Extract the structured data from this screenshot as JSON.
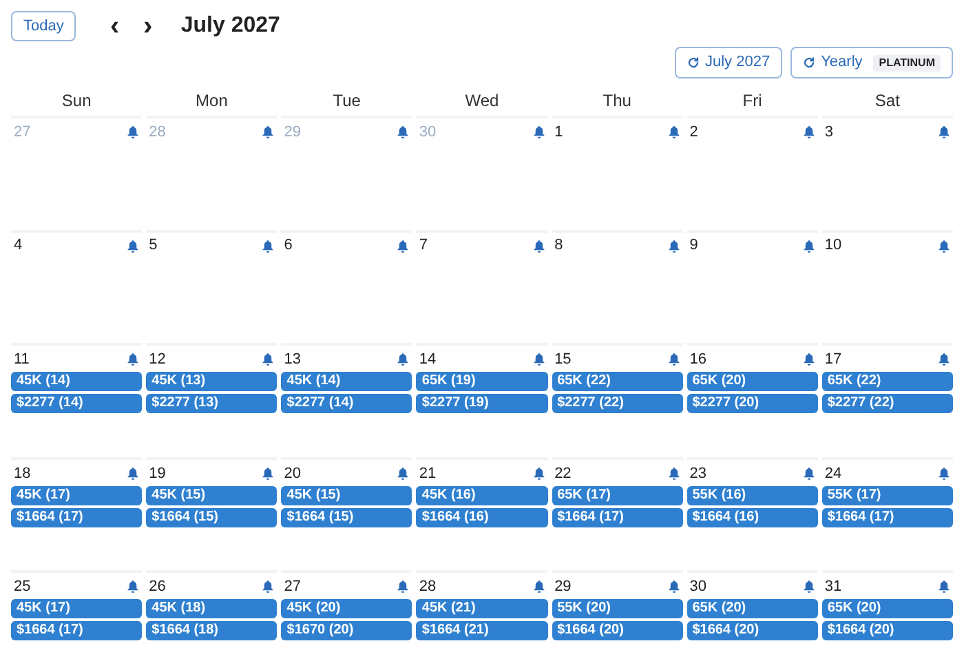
{
  "toolbar": {
    "today_button": "Today",
    "prev_icon": "‹",
    "next_icon": "›",
    "title": "July 2027"
  },
  "actions": [
    {
      "label": "July 2027"
    },
    {
      "label": "Yearly",
      "badge": "PLATINUM"
    }
  ],
  "weekdays": [
    "Sun",
    "Mon",
    "Tue",
    "Wed",
    "Thu",
    "Fri",
    "Sat"
  ],
  "days": [
    {
      "day": "27",
      "outside": true
    },
    {
      "day": "28",
      "outside": true
    },
    {
      "day": "29",
      "outside": true
    },
    {
      "day": "30",
      "outside": true
    },
    {
      "day": "1",
      "outside": false
    },
    {
      "day": "2",
      "outside": false
    },
    {
      "day": "3",
      "outside": false
    },
    {
      "day": "4",
      "outside": false
    },
    {
      "day": "5",
      "outside": false
    },
    {
      "day": "6",
      "outside": false
    },
    {
      "day": "7",
      "outside": false
    },
    {
      "day": "8",
      "outside": false
    },
    {
      "day": "9",
      "outside": false
    },
    {
      "day": "10",
      "outside": false
    },
    {
      "day": "11",
      "outside": false,
      "events": [
        "45K (14)",
        "$2277 (14)"
      ]
    },
    {
      "day": "12",
      "outside": false,
      "events": [
        "45K (13)",
        "$2277 (13)"
      ]
    },
    {
      "day": "13",
      "outside": false,
      "events": [
        "45K (14)",
        "$2277 (14)"
      ]
    },
    {
      "day": "14",
      "outside": false,
      "events": [
        "65K (19)",
        "$2277 (19)"
      ]
    },
    {
      "day": "15",
      "outside": false,
      "events": [
        "65K (22)",
        "$2277 (22)"
      ]
    },
    {
      "day": "16",
      "outside": false,
      "events": [
        "65K (20)",
        "$2277 (20)"
      ]
    },
    {
      "day": "17",
      "outside": false,
      "events": [
        "65K (22)",
        "$2277 (22)"
      ]
    },
    {
      "day": "18",
      "outside": false,
      "events": [
        "45K (17)",
        "$1664 (17)"
      ]
    },
    {
      "day": "19",
      "outside": false,
      "events": [
        "45K (15)",
        "$1664 (15)"
      ]
    },
    {
      "day": "20",
      "outside": false,
      "events": [
        "45K (15)",
        "$1664 (15)"
      ]
    },
    {
      "day": "21",
      "outside": false,
      "events": [
        "45K (16)",
        "$1664 (16)"
      ]
    },
    {
      "day": "22",
      "outside": false,
      "events": [
        "65K (17)",
        "$1664 (17)"
      ]
    },
    {
      "day": "23",
      "outside": false,
      "events": [
        "55K (16)",
        "$1664 (16)"
      ]
    },
    {
      "day": "24",
      "outside": false,
      "events": [
        "55K (17)",
        "$1664 (17)"
      ]
    },
    {
      "day": "25",
      "outside": false,
      "events": [
        "45K (17)",
        "$1664 (17)"
      ]
    },
    {
      "day": "26",
      "outside": false,
      "events": [
        "45K (18)",
        "$1664 (18)"
      ]
    },
    {
      "day": "27",
      "outside": false,
      "events": [
        "45K (20)",
        "$1670 (20)"
      ]
    },
    {
      "day": "28",
      "outside": false,
      "events": [
        "45K (21)",
        "$1664 (21)"
      ]
    },
    {
      "day": "29",
      "outside": false,
      "events": [
        "55K (20)",
        "$1664 (20)"
      ]
    },
    {
      "day": "30",
      "outside": false,
      "events": [
        "65K (20)",
        "$1664 (20)"
      ]
    },
    {
      "day": "31",
      "outside": false,
      "events": [
        "65K (20)",
        "$1664 (20)"
      ]
    }
  ]
}
